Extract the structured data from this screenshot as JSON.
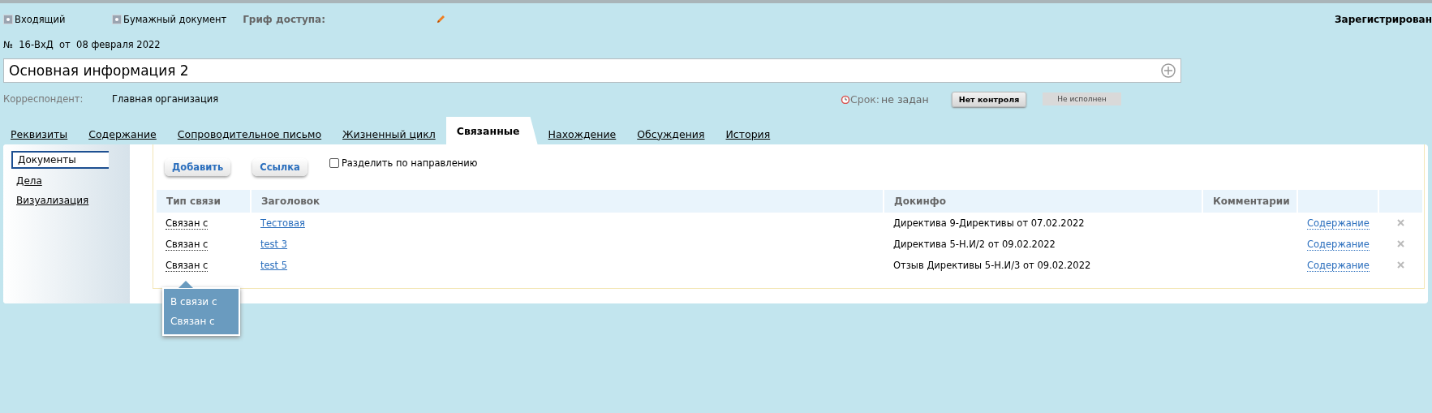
{
  "header": {
    "flags": [
      "Входящий",
      "Бумажный документ"
    ],
    "access_label": "Гриф доступа:",
    "status": "Зарегистрирован",
    "number": "№  16-ВхД  от  08 февраля 2022"
  },
  "title_field": {
    "value": "Основная информация 2"
  },
  "info": {
    "correspondent_label": "Корреспондент:",
    "correspondent": "Главная организация",
    "deadline_label": "Срок:",
    "deadline": "не задан",
    "control_button": "Нет контроля",
    "execution_status": "Не исполнен"
  },
  "tabs": [
    {
      "label": "Реквизиты",
      "selected": false
    },
    {
      "label": "Содержание",
      "selected": false
    },
    {
      "label": "Сопроводительное письмо",
      "selected": false
    },
    {
      "label": "Жизненный цикл",
      "selected": false
    },
    {
      "label": "Связанные",
      "selected": true
    },
    {
      "label": "Нахождение",
      "selected": false
    },
    {
      "label": "Обсуждения",
      "selected": false
    },
    {
      "label": "История",
      "selected": false
    }
  ],
  "sidebar": {
    "items": [
      {
        "label": "Документы",
        "selected": true
      },
      {
        "label": "Дела",
        "selected": false
      },
      {
        "label": "Визуализация",
        "selected": false
      }
    ]
  },
  "toolbar": {
    "buttons": [
      "Добавить",
      "Ссылка"
    ],
    "split_checkbox": {
      "label": "Разделить по направлению",
      "checked": false
    }
  },
  "table": {
    "columns": [
      "Тип связи",
      "Заголовок",
      "Докинфо",
      "Комментарии"
    ],
    "rows": [
      {
        "type": "Связан с",
        "title": "Тестовая",
        "docinfo": "Директива 9-Директивы от 07.02.2022",
        "action": "Содержание"
      },
      {
        "type": "Связан с",
        "title": "test 3",
        "docinfo": "Директива 5-Н.И/2 от 09.02.2022",
        "action": "Содержание"
      },
      {
        "type": "Связан с",
        "title": "test 5",
        "docinfo": "Отзыв Директивы 5-Н.И/3 от 09.02.2022",
        "action": "Содержание"
      }
    ]
  },
  "popup": {
    "items": [
      "В связи с",
      "Связан с"
    ]
  }
}
